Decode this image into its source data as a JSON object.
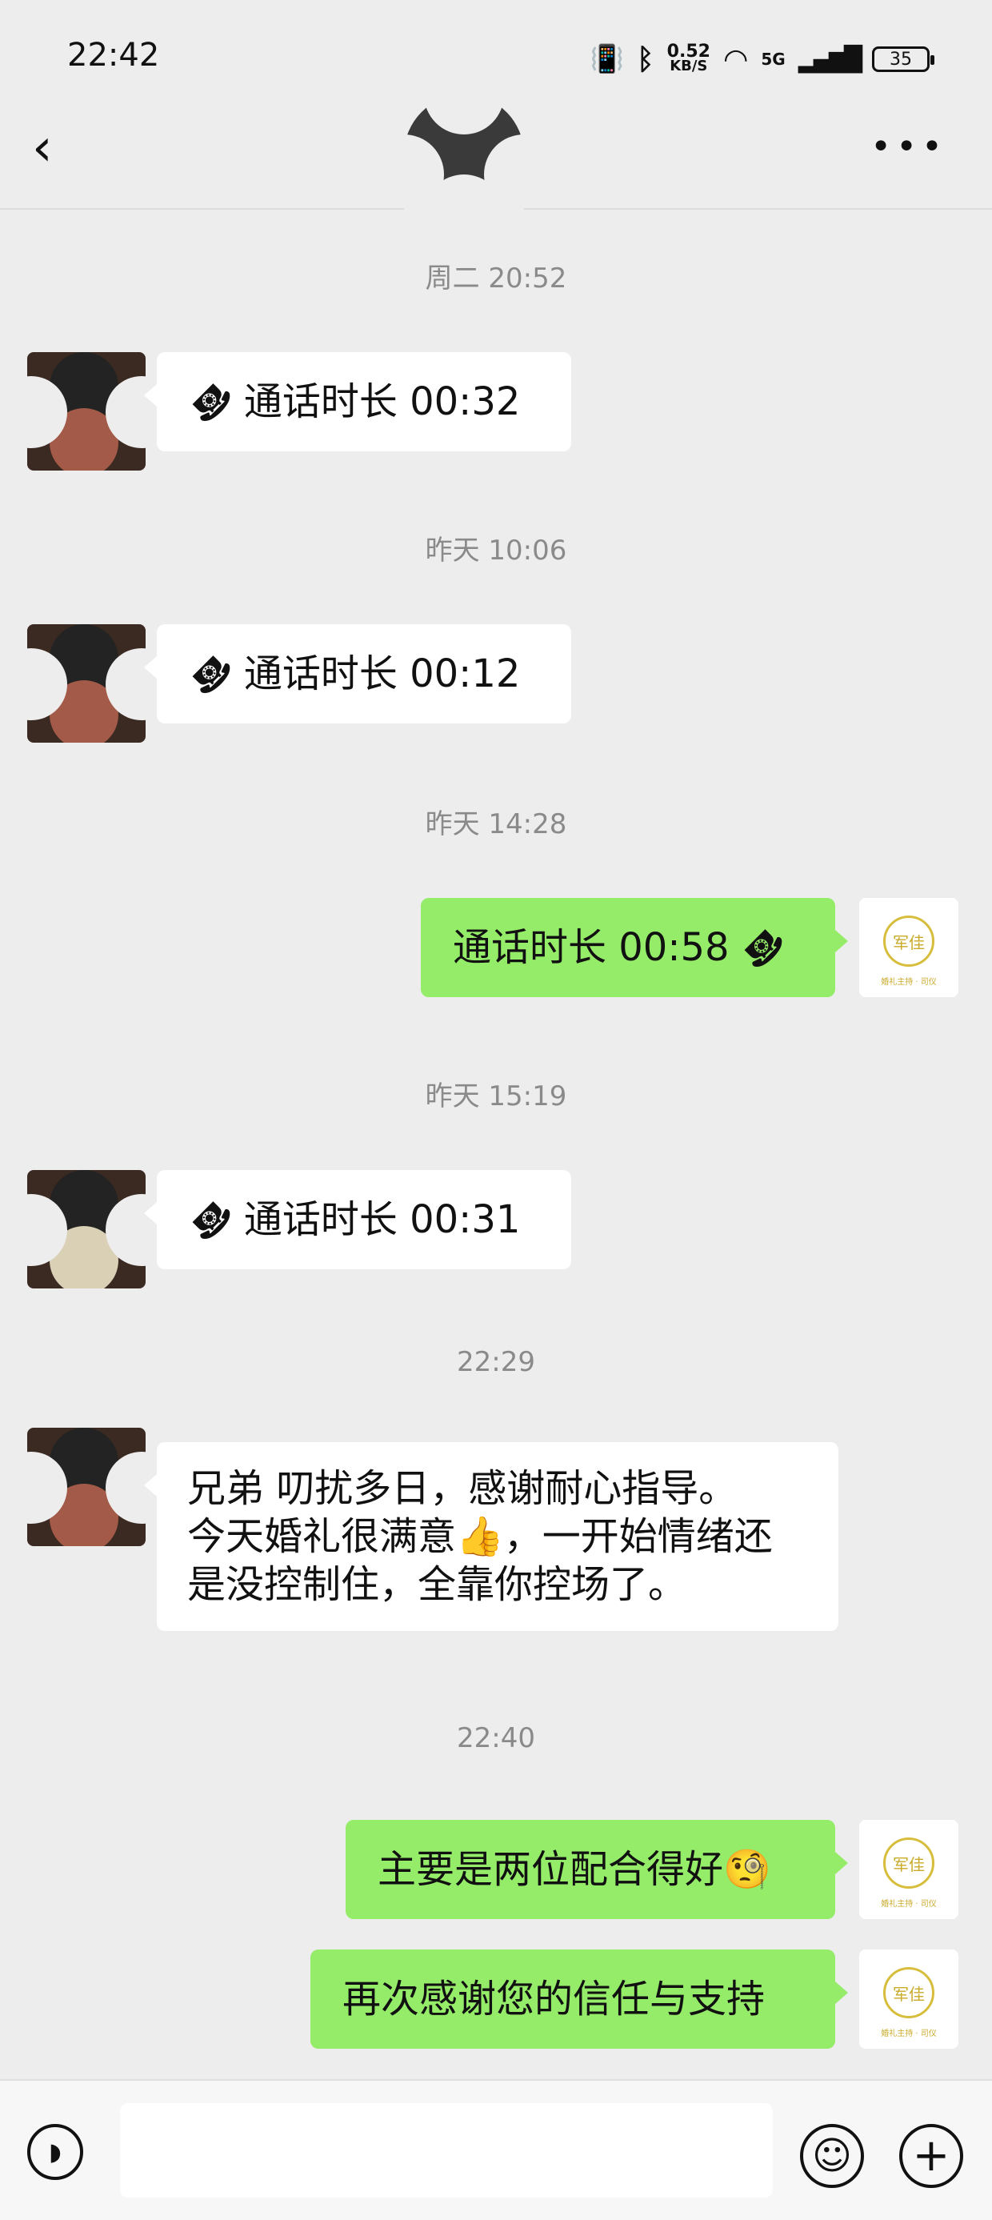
{
  "status_bar": {
    "time": "22:42",
    "net_speed": "0.52",
    "net_unit": "KB/S",
    "signal_label": "5G",
    "battery": "35"
  },
  "nav": {
    "back_icon": "chevron-left-icon",
    "more_icon": "more-icon"
  },
  "messages": [
    {
      "type": "timestamp",
      "text": "周二 20:52"
    },
    {
      "type": "call",
      "side": "in",
      "label": "通话时长 00:32"
    },
    {
      "type": "timestamp",
      "text": "昨天 10:06"
    },
    {
      "type": "call",
      "side": "in",
      "label": "通话时长 00:12"
    },
    {
      "type": "timestamp",
      "text": "昨天 14:28"
    },
    {
      "type": "call",
      "side": "out",
      "label": "通话时长 00:58"
    },
    {
      "type": "timestamp",
      "text": "昨天 15:19"
    },
    {
      "type": "call",
      "side": "in",
      "label": "通话时长 00:31"
    },
    {
      "type": "timestamp",
      "text": "22:29"
    },
    {
      "type": "text",
      "side": "in",
      "lines": [
        "兄弟 叨扰多日，感谢耐心指导。",
        "今天婚礼很满意👍，一开始情绪还",
        "是没控制住，全靠你控场了。"
      ]
    },
    {
      "type": "timestamp",
      "text": "22:40"
    },
    {
      "type": "text",
      "side": "out",
      "text": "主要是两位配合得好🧐"
    },
    {
      "type": "text",
      "side": "out",
      "text": "再次感谢您的信任与支持"
    }
  ],
  "my_avatar_logo": {
    "glyph": "军佳",
    "subtitle": "婚礼主持 · 司仪"
  },
  "composer": {
    "voice_icon": "voice-icon",
    "input_value": "",
    "emoji_icon": "emoji-icon",
    "plus_icon": "plus-icon"
  },
  "colors": {
    "background": "#ededed",
    "bubble_out": "#95ec69",
    "bubble_in": "#ffffff"
  }
}
